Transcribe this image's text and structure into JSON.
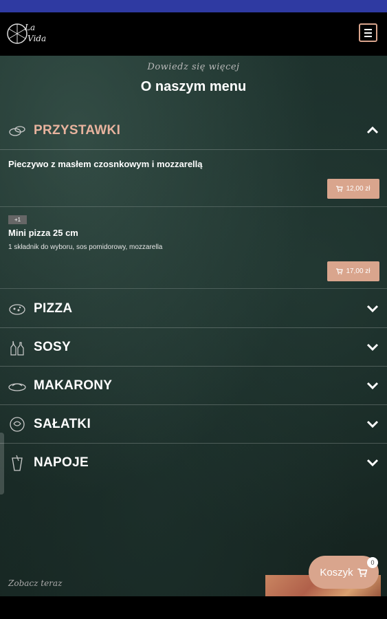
{
  "header": {
    "logo_text": "La Vida",
    "menu_icon": "hamburger-icon"
  },
  "intro": {
    "subtitle": "Dowiedz się więcej",
    "title": "O naszym menu"
  },
  "categories": [
    {
      "label": "PRZYSTAWKI",
      "icon": "appetizer-icon",
      "expanded": true
    },
    {
      "label": "PIZZA",
      "icon": "pizza-icon",
      "expanded": false
    },
    {
      "label": "SOSY",
      "icon": "sauce-icon",
      "expanded": false
    },
    {
      "label": "MAKARONY",
      "icon": "pasta-icon",
      "expanded": false
    },
    {
      "label": "SAŁATKI",
      "icon": "salad-icon",
      "expanded": false
    },
    {
      "label": "NAPOJE",
      "icon": "drinks-icon",
      "expanded": false
    }
  ],
  "items": [
    {
      "name": "Pieczywo z masłem czosnkowym i mozzarellą",
      "description": "",
      "badge": "",
      "price": "12,00 zł"
    },
    {
      "name": "Mini pizza 25 cm",
      "description": "1 składnik do wyboru, sos pomidorowy, mozzarella",
      "badge": "+1",
      "price": "17,00 zł"
    }
  ],
  "footer": {
    "see_now": "Zobacz teraz",
    "cart_label": "Koszyk",
    "cart_count": "0"
  },
  "colors": {
    "accent": "#d9a58d",
    "status_bar": "#2f3aa2",
    "background": "#1a2c28"
  }
}
